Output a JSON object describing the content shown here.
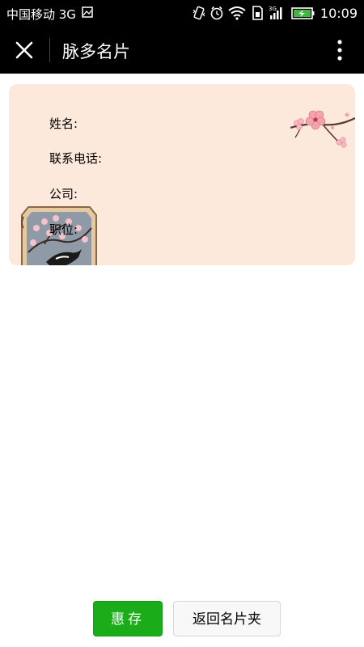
{
  "status_bar": {
    "carrier": "中国移动 3G",
    "network_badge": "3G",
    "time": "10:09"
  },
  "title_bar": {
    "title": "脉多名片"
  },
  "card": {
    "fields": [
      {
        "label": "姓名:"
      },
      {
        "label": "联系电话:"
      },
      {
        "label": "公司:"
      },
      {
        "label": "职位:"
      }
    ],
    "background_color": "#fce9dc"
  },
  "buttons": {
    "save_label": "惠存",
    "back_label": "返回名片夹",
    "save_color": "#1aad19"
  },
  "icons": {
    "close": "close-icon",
    "more": "more-vertical-icon"
  }
}
